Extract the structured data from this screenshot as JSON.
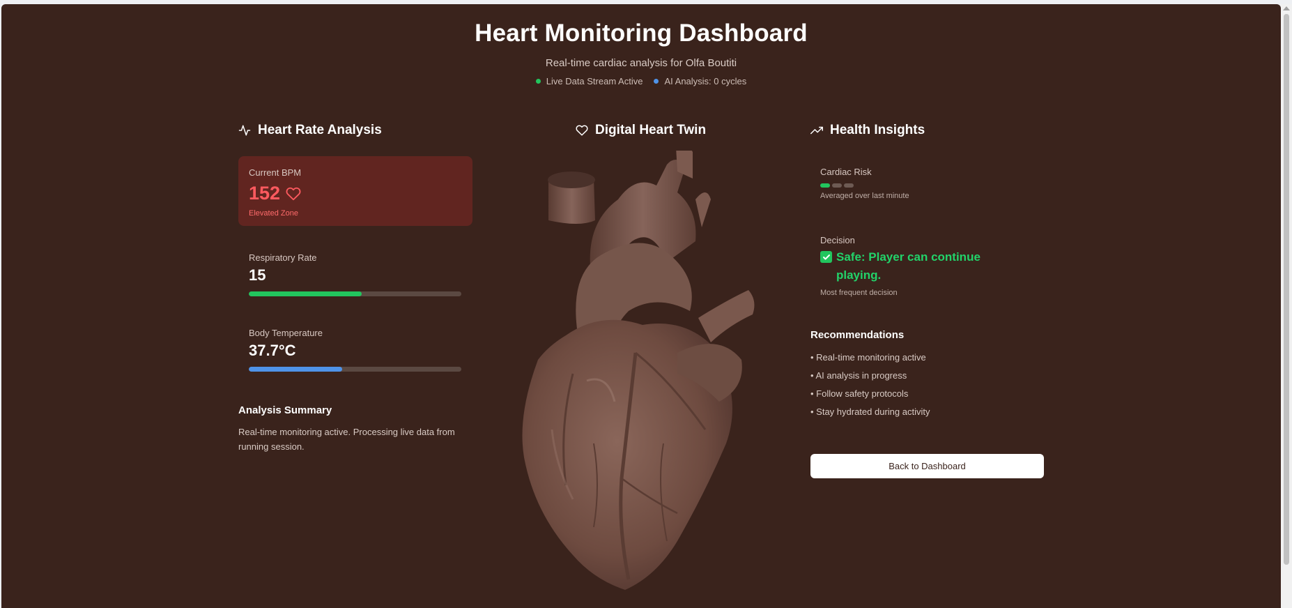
{
  "header": {
    "title": "Heart Monitoring Dashboard",
    "subtitle": "Real-time cardiac analysis for Olfa Boutiti",
    "status_live": "Live Data Stream Active",
    "status_ai": "AI Analysis: 0 cycles",
    "status_live_color": "#22c55e",
    "status_ai_color": "#4f93e8"
  },
  "left": {
    "title": "Heart Rate Analysis",
    "icon": "activity-icon",
    "bpm": {
      "label": "Current BPM",
      "value": "152",
      "zone": "Elevated Zone",
      "icon": "heart-icon"
    },
    "respiratory": {
      "label": "Respiratory Rate",
      "value": "15",
      "progress": 0.53,
      "color": "#22c55e"
    },
    "temperature": {
      "label": "Body Temperature",
      "value": "37.7°C",
      "progress": 0.44,
      "color": "#4f93e8"
    },
    "summary_title": "Analysis Summary",
    "summary_text": "Real-time monitoring active. Processing live data from running session."
  },
  "center": {
    "title": "Digital Heart Twin",
    "icon": "heart-outline-icon"
  },
  "right": {
    "title": "Health Insights",
    "icon": "trending-up-icon",
    "cardiac_risk": {
      "label": "Cardiac Risk",
      "level": 1,
      "levels": 3,
      "note": "Averaged over last minute"
    },
    "decision": {
      "label": "Decision",
      "text": "Safe: Player can continue playing.",
      "note": "Most frequent decision"
    },
    "recommendations_title": "Recommendations",
    "recommendations": [
      "• Real-time monitoring active",
      "• AI analysis in progress",
      "• Follow safety protocols",
      "• Stay hydrated during activity"
    ],
    "back_button": "Back to Dashboard"
  },
  "colors": {
    "background": "#3a231c",
    "bpm_card": "#612520",
    "bpm_text": "#ff5a5f",
    "safe": "#22d36a"
  }
}
